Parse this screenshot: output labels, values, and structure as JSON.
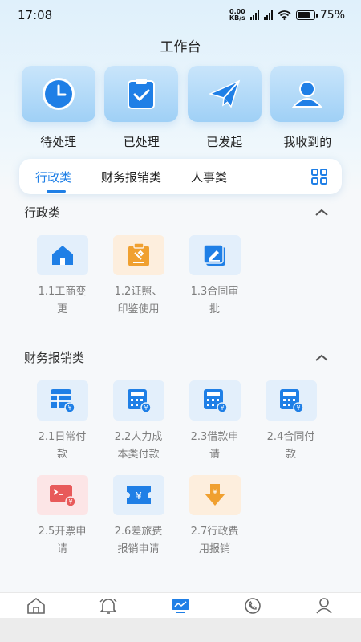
{
  "status": {
    "time": "17:08",
    "net_speed_value": "0.00",
    "net_speed_unit": "KB/s",
    "battery": "75%",
    "battery_level": 0.75
  },
  "page_title": "工作台",
  "quick_actions": [
    {
      "label": "待处理",
      "icon": "clock-icon"
    },
    {
      "label": "已处理",
      "icon": "clipboard-check-icon"
    },
    {
      "label": "已发起",
      "icon": "paper-plane-icon"
    },
    {
      "label": "我收到的",
      "icon": "user-icon"
    }
  ],
  "tabs": [
    {
      "label": "行政类",
      "active": true
    },
    {
      "label": "财务报销类",
      "active": false
    },
    {
      "label": "人事类",
      "active": false
    }
  ],
  "sections": {
    "admin": {
      "title": "行政类",
      "items": [
        {
          "label": "1.1工商变更",
          "icon": "house-icon"
        },
        {
          "label": "1.2证照、印鉴使用",
          "icon": "seal-document-icon"
        },
        {
          "label": "1.3合同审批",
          "icon": "edit-document-icon"
        }
      ]
    },
    "finance": {
      "title": "财务报销类",
      "items": [
        {
          "label": "2.1日常付款",
          "icon": "table-yuan-icon"
        },
        {
          "label": "2.2人力成本类付款",
          "icon": "calculator-yuan-icon"
        },
        {
          "label": "2.3借款申请",
          "icon": "calculator-yuan-icon"
        },
        {
          "label": "2.4合同付款",
          "icon": "calculator-yuan-icon"
        },
        {
          "label": "2.5开票申请",
          "icon": "invoice-terminal-icon"
        },
        {
          "label": "2.6差旅费报销申请",
          "icon": "ticket-yuan-icon"
        },
        {
          "label": "2.7行政费用报销",
          "icon": "download-yuan-icon"
        }
      ]
    }
  },
  "bottom_nav": [
    "home-icon",
    "bell-icon",
    "workbench-icon",
    "phone-icon",
    "contacts-icon"
  ],
  "colors": {
    "accent": "#1f7fe6",
    "orange": "#f0a030",
    "red": "#e85a5a"
  }
}
